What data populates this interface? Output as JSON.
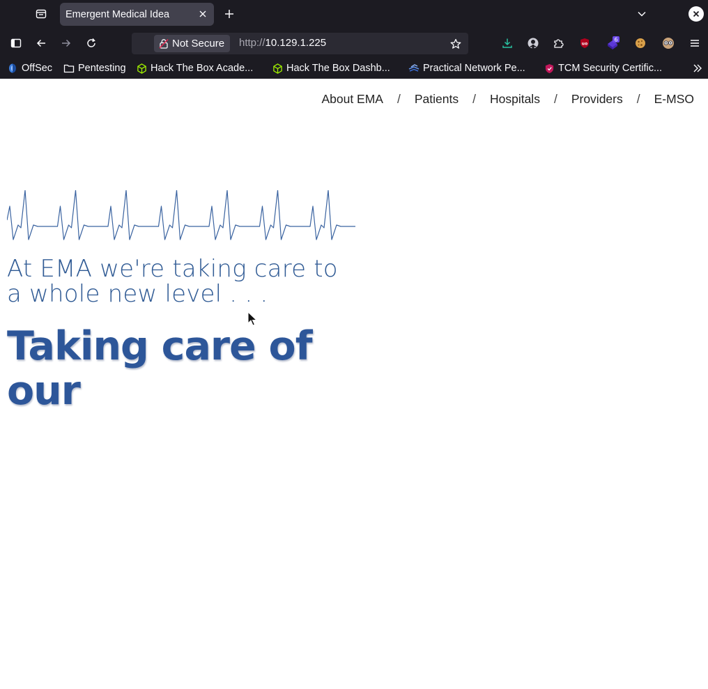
{
  "browser": {
    "tab_title": "Emergent Medical Idea",
    "security_label": "Not Secure",
    "url_scheme": "http://",
    "url_host": "10.129.1.225",
    "extension_badge": "6"
  },
  "bookmarks": [
    {
      "label": "OffSec"
    },
    {
      "label": "Pentesting"
    },
    {
      "label": "Hack The Box Acade..."
    },
    {
      "label": "Hack The Box Dashb..."
    },
    {
      "label": "Practical Network Pe..."
    },
    {
      "label": "TCM Security Certific..."
    }
  ],
  "site": {
    "nav": [
      {
        "label": "About EMA"
      },
      {
        "label": "Patients"
      },
      {
        "label": "Hospitals"
      },
      {
        "label": "Providers"
      },
      {
        "label": "E-MSO"
      }
    ],
    "separator": "/",
    "tagline": "At EMA we're taking care to a whole new level . . .",
    "headline": "Taking care of our"
  },
  "colors": {
    "chrome_bg": "#1c1b22",
    "tab_active": "#42414d",
    "accent_blue": "#2d5699",
    "ekg_line": "#3a63a0"
  }
}
